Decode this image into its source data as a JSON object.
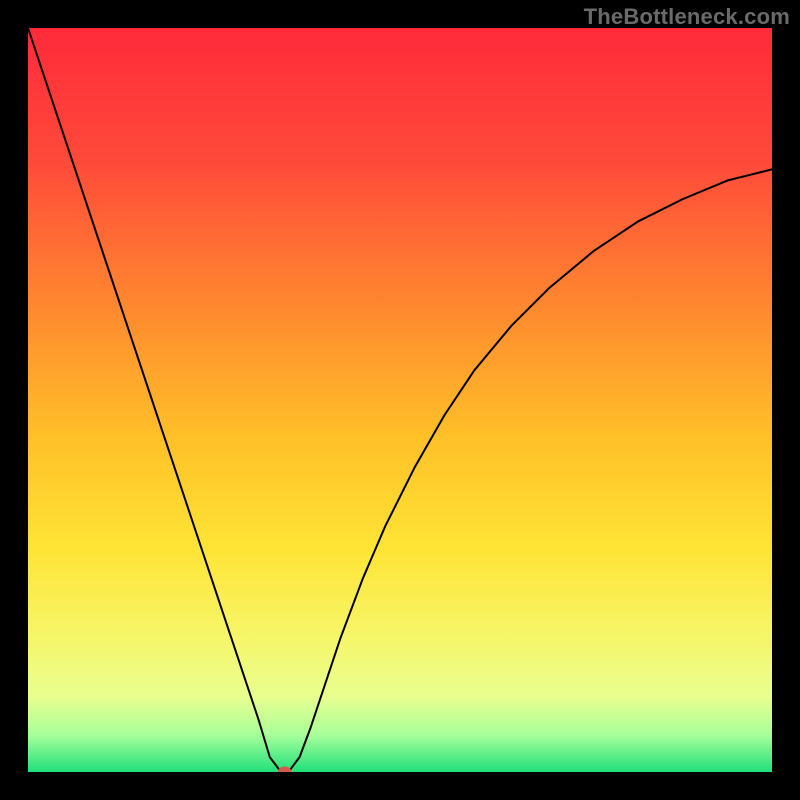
{
  "watermark": "TheBottleneck.com",
  "chart_data": {
    "type": "line",
    "title": "",
    "xlabel": "",
    "ylabel": "",
    "xlim": [
      0,
      100
    ],
    "ylim": [
      0,
      100
    ],
    "grid": false,
    "legend": false,
    "gradient_stops": [
      {
        "offset": 0,
        "color": "#ff2a3a"
      },
      {
        "offset": 18,
        "color": "#ff4a3a"
      },
      {
        "offset": 38,
        "color": "#ff8a2f"
      },
      {
        "offset": 55,
        "color": "#ffc028"
      },
      {
        "offset": 70,
        "color": "#ffe435"
      },
      {
        "offset": 82,
        "color": "#f6f66a"
      },
      {
        "offset": 90,
        "color": "#e8ff8f"
      },
      {
        "offset": 95,
        "color": "#a8ff9a"
      },
      {
        "offset": 100,
        "color": "#20e07a"
      }
    ],
    "series": [
      {
        "name": "bottleneck-curve",
        "stroke": "#000000",
        "stroke_width": 2,
        "x": [
          0,
          3,
          6,
          9,
          12,
          15,
          18,
          21,
          24,
          27,
          29,
          31,
          32.5,
          34,
          35,
          36.5,
          38,
          40,
          42,
          45,
          48,
          52,
          56,
          60,
          65,
          70,
          76,
          82,
          88,
          94,
          100
        ],
        "y": [
          100,
          91,
          82,
          73,
          64,
          55,
          46,
          37,
          28,
          19,
          13,
          7,
          2,
          0,
          0,
          2,
          6,
          12,
          18,
          26,
          33,
          41,
          48,
          54,
          60,
          65,
          70,
          74,
          77,
          79.5,
          81
        ]
      }
    ],
    "marker": {
      "name": "minimum-point",
      "x": 34.5,
      "y": 0,
      "rx": 7,
      "ry": 5.5,
      "fill": "#d45a4a"
    }
  }
}
